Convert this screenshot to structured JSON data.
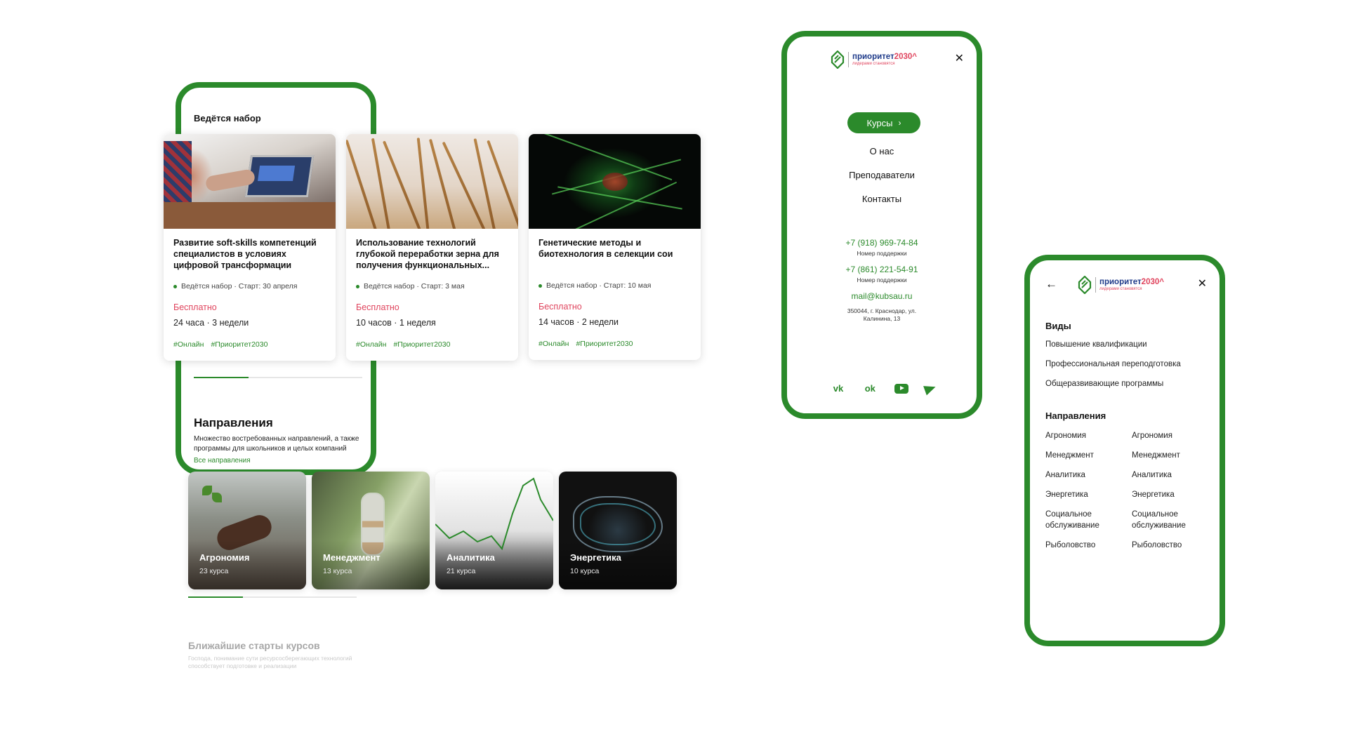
{
  "brand": {
    "name": "приоритет",
    "year": "2030",
    "caret": "^",
    "tagline": "лидерами становятся"
  },
  "colors": {
    "accent": "#2b8a2b",
    "price": "#e0455e",
    "brand_blue": "#1f3b8a"
  },
  "screen1": {
    "section_title": "Ведётся набор",
    "directions_title": "Направления",
    "directions_desc": "Множество востребованных направлений, а также программы для школьников и целых компаний",
    "all_directions_link": "Все направления",
    "upcoming_title": "Ближайшие старты курсов",
    "upcoming_desc": "Господа, понимание сути ресурсосберегающих технологий способствует подготовке и реализации"
  },
  "cards": [
    {
      "title": "Развитие soft-skills компетенций специалистов в условиях цифровой трансформации",
      "status": "Ведётся набор · Старт: 30 апреля",
      "price": "Бесплатно",
      "duration": "24 часа · 3 недели",
      "tags": [
        "#Онлайн",
        "#Приоритет2030"
      ]
    },
    {
      "title": "Использование технологий глубокой переработки зерна для получения функциональных...",
      "status": "Ведётся набор · Старт: 3 мая",
      "price": "Бесплатно",
      "duration": "10 часов · 1 неделя",
      "tags": [
        "#Онлайн",
        "#Приоритет2030"
      ]
    },
    {
      "title": "Генетические методы и биотехнология в селекции сои",
      "status": "Ведётся набор · Старт: 10 мая",
      "price": "Бесплатно",
      "duration": "14 часов · 2 недели",
      "tags": [
        "#Онлайн",
        "#Приоритет2030"
      ]
    }
  ],
  "tiles": [
    {
      "name": "Агрономия",
      "count": "23 курса"
    },
    {
      "name": "Менеджмент",
      "count": "13 курса"
    },
    {
      "name": "Аналитика",
      "count": "21 курса"
    },
    {
      "name": "Энергетика",
      "count": "10 курса"
    }
  ],
  "menu": {
    "courses_button": "Курсы",
    "items": [
      "О нас",
      "Преподаватели",
      "Контакты"
    ],
    "phones": [
      {
        "number": "+7 (918) 969-74-84",
        "label": "Номер поддержки"
      },
      {
        "number": "+7 (861) 221-54-91",
        "label": "Номер поддержки"
      }
    ],
    "email": "mail@kubsau.ru",
    "address_line1": "350044, г. Краснодар, ул.",
    "address_line2": "Калинина, 13",
    "socials": [
      "vk-icon",
      "ok-icon",
      "youtube-icon",
      "telegram-icon"
    ]
  },
  "catalog": {
    "types_title": "Виды",
    "types": [
      "Повышение квалификации",
      "Профессиональная переподготовка",
      "Общеразвивающие программы"
    ],
    "directions_title": "Направления",
    "directions_col1": [
      "Агрономия",
      "Менеджмент",
      "Аналитика",
      "Энергетика",
      "Социальное обслуживание",
      "Рыболовство"
    ],
    "directions_col2": [
      "Агрономия",
      "Менеджмент",
      "Аналитика",
      "Энергетика",
      "Социальное обслуживание",
      "Рыболовство"
    ]
  }
}
